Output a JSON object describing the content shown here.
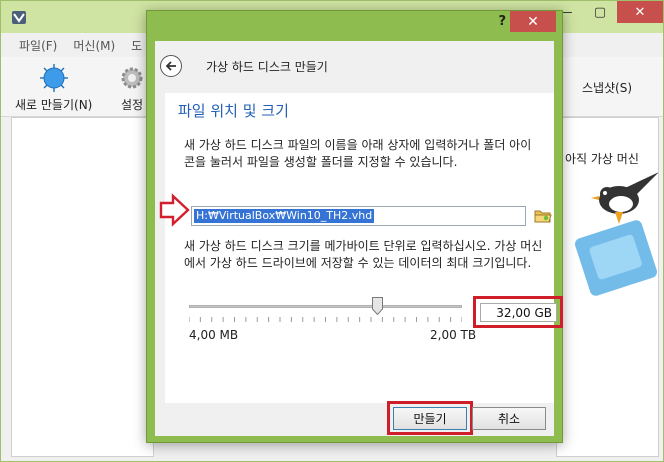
{
  "background_window": {
    "menu": [
      "파일(F)",
      "머신(M)",
      "도"
    ],
    "toolbar": {
      "new_label": "새로 만들기(N)",
      "settings_label": "설정",
      "snapshot_tab": "스냅샷(S)"
    },
    "right_panel_text": "아직 가상 머신"
  },
  "dialog": {
    "help_label": "?",
    "close_label": "✕",
    "title": "가상 하드 디스크 만들기",
    "section_title": "파일 위치 및 크기",
    "location_description": "새 가상 하드 디스크 파일의 이름을 아래 상자에 입력하거나 폴더 아이콘을 눌러서 파일을 생성할 폴더를 지정할 수 있습니다.",
    "file_path": "H:₩VirtualBox₩Win10_TH2.vhd",
    "size_description": "새 가상 하드 디스크 크기를 메가바이트 단위로 입력하십시오. 가상 머신에서 가상 하드 드라이브에 저장할 수 있는 데이터의 최대 크기입니다.",
    "size_value": "32,00 GB",
    "slider_min": "4,00 MB",
    "slider_max": "2,00 TB",
    "slider_fraction": 0.69,
    "create_button": "만들기",
    "cancel_button": "취소"
  },
  "colors": {
    "accent_green": "#8fbc4e",
    "highlight_red": "#cf1d2a",
    "title_blue": "#2460b6",
    "selection_blue": "#3574d4"
  }
}
